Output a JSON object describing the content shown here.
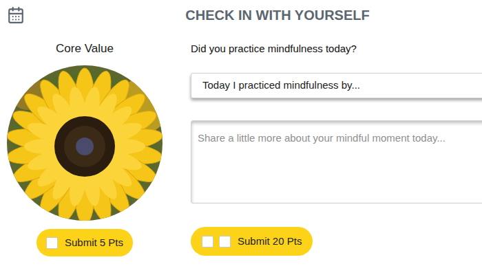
{
  "header": {
    "title": "CHECK IN WITH YOURSELF"
  },
  "core_value": {
    "label": "Core Value",
    "button": {
      "label": "Submit 5 Pts",
      "checked": false
    }
  },
  "question": {
    "label": "Did you practice mindfulness today?",
    "select": {
      "value": "Today I practiced mindfulness by..."
    },
    "textarea": {
      "placeholder": "Share a little more about your mindful moment today..."
    },
    "button": {
      "label": "Submit 20 Pts",
      "checkboxes": [
        {
          "checked": false
        },
        {
          "checked": false
        }
      ]
    }
  }
}
